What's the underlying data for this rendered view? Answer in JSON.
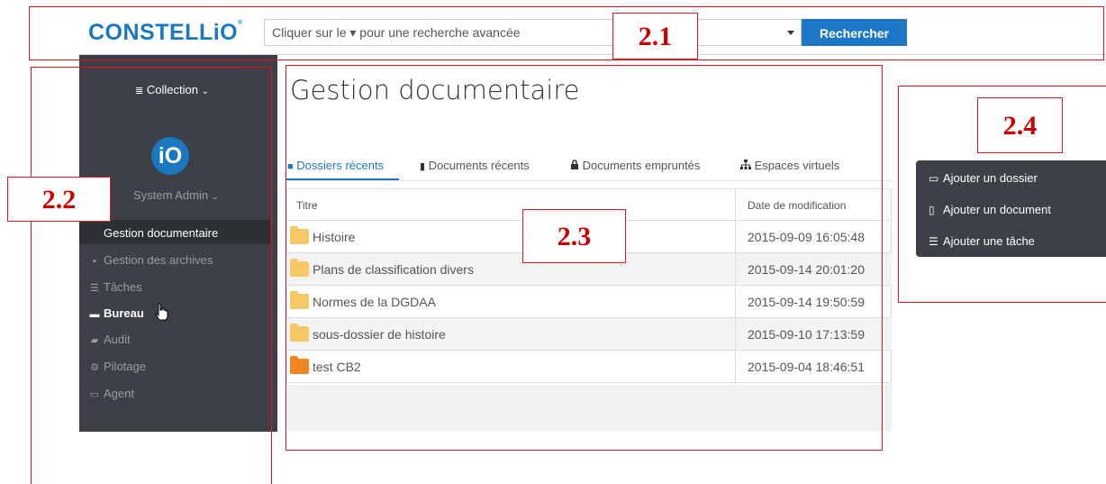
{
  "header": {
    "logo": "CONSTELLiO",
    "logo_mark": "®",
    "search_placeholder": "Cliquer sur le ▾ pour une recherche avancée",
    "search_button": "Rechercher"
  },
  "sidebar": {
    "collection_label": "Collection",
    "avatar_text": "iO",
    "user_name": "System Admin",
    "items": [
      {
        "label": "Gestion documentaire",
        "icon": "folder-icon",
        "glyph": "",
        "active": true
      },
      {
        "label": "Gestion des archives",
        "icon": "archive-icon",
        "glyph": "▪"
      },
      {
        "label": "Tâches",
        "icon": "tasks-icon",
        "glyph": "☰"
      },
      {
        "label": "Bureau",
        "icon": "briefcase-icon",
        "glyph": "▬",
        "highlighted": true
      },
      {
        "label": "Audit",
        "icon": "book-icon",
        "glyph": "▰"
      },
      {
        "label": "Pilotage",
        "icon": "cogs-icon",
        "glyph": "⚙"
      },
      {
        "label": "Agent",
        "icon": "laptop-icon",
        "glyph": "▭"
      }
    ]
  },
  "main": {
    "title": "Gestion documentaire",
    "tabs": [
      {
        "label": "Dossiers récents",
        "icon": "folder-icon",
        "glyph": "■",
        "active": true
      },
      {
        "label": "Documents récents",
        "icon": "file-icon",
        "glyph": "▮"
      },
      {
        "label": "Documents empruntés",
        "icon": "lock-icon",
        "glyph": "🔒"
      },
      {
        "label": "Espaces virtuels",
        "icon": "sitemap-icon",
        "glyph": "⧉"
      }
    ],
    "table": {
      "columns": [
        "Titre",
        "Date de modification"
      ],
      "rows": [
        {
          "title": "Histoire",
          "date": "2015-09-09 16:05:48",
          "folder_color": "#f7c866"
        },
        {
          "title": "Plans de classification divers",
          "date": "2015-09-14 20:01:20",
          "folder_color": "#f7c866"
        },
        {
          "title": "Normes de la DGDAA",
          "date": "2015-09-14 19:50:59",
          "folder_color": "#f7c866"
        },
        {
          "title": "sous-dossier de histoire",
          "date": "2015-09-10 17:13:59",
          "folder_color": "#f7c866"
        },
        {
          "title": "test CB2",
          "date": "2015-09-04 18:46:51",
          "folder_color": "#f2851f"
        }
      ]
    }
  },
  "actions": [
    {
      "label": "Ajouter un dossier",
      "icon": "folder-open-icon",
      "glyph": "▭"
    },
    {
      "label": "Ajouter un document",
      "icon": "file-icon",
      "glyph": "▯"
    },
    {
      "label": "Ajouter une tâche",
      "icon": "tasks-icon",
      "glyph": "☰"
    }
  ],
  "annotations": [
    "2.1",
    "2.2",
    "2.3",
    "2.4"
  ],
  "colors": {
    "brand": "#1a79be",
    "sidebar": "#3d4147",
    "annotation": "#e8141b"
  }
}
